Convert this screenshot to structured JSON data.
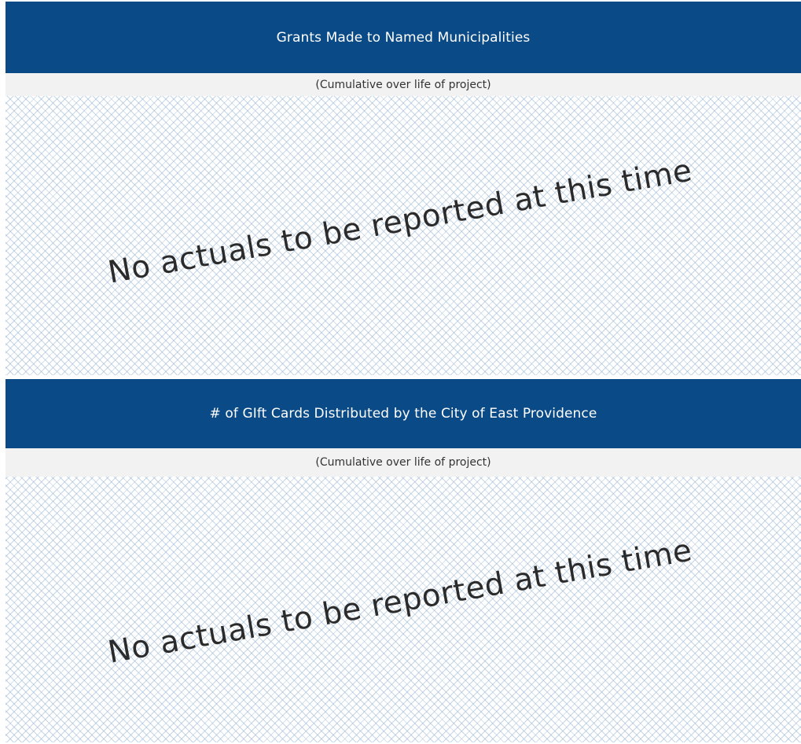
{
  "panels": [
    {
      "title": "Grants Made to Named Municipalities",
      "subtitle": "(Cumulative over life of project)",
      "message": "No actuals to be reported at this time"
    },
    {
      "title": "# of GIft Cards Distributed by the City of East Providence",
      "subtitle": "(Cumulative over life of project)",
      "message": "No actuals to be reported at this time"
    }
  ],
  "colors": {
    "header_background": "#0a4a86",
    "header_text": "#ffffff",
    "subheader_background": "#f2f2f2",
    "pattern": "#96b4d2"
  }
}
